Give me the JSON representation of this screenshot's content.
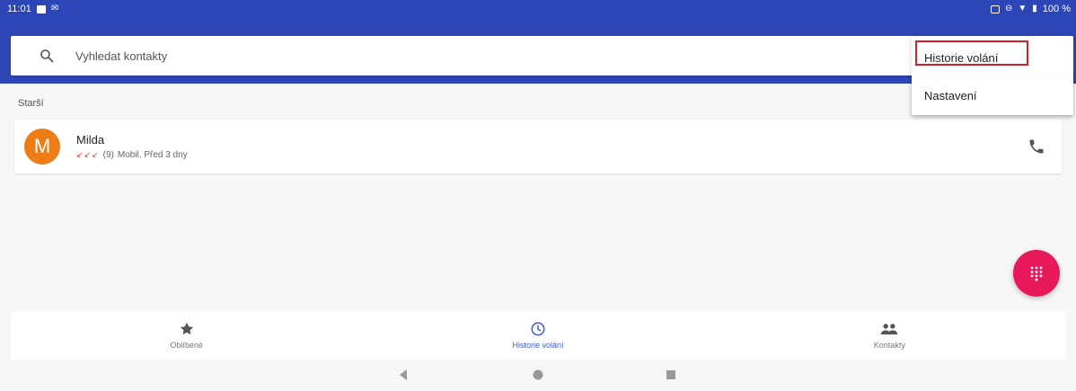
{
  "status_bar": {
    "time": "11:01",
    "battery": "100 %"
  },
  "search": {
    "placeholder": "Vyhledat kontakty"
  },
  "section": {
    "label": "Starší"
  },
  "call_log": [
    {
      "avatar_letter": "M",
      "name": "Milda",
      "count": "(9)",
      "detail": "Mobil, Před 3 dny",
      "avatar_color": "#ef7d16",
      "missed_color": "#e23b3b"
    }
  ],
  "overflow_menu": {
    "items": [
      {
        "label": "Historie volání"
      },
      {
        "label": "Nastavení"
      }
    ],
    "highlight_color": "#d41e2a"
  },
  "bottom_nav": {
    "tabs": [
      {
        "label": "Oblíbené",
        "icon": "star-icon"
      },
      {
        "label": "Historie volání",
        "icon": "clock-icon"
      },
      {
        "label": "Kontakty",
        "icon": "people-icon"
      }
    ],
    "active_index": 1
  },
  "colors": {
    "primary": "#2c46b8",
    "accent": "#e8195a",
    "active_tab": "#3b5bd6"
  }
}
